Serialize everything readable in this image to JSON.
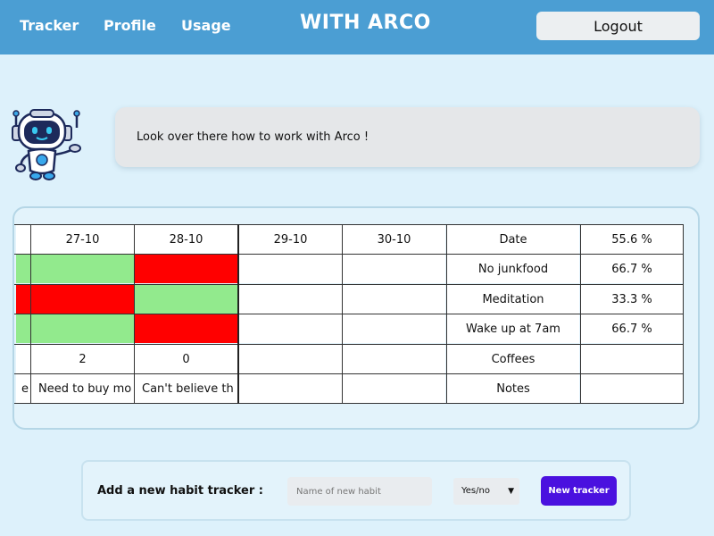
{
  "nav": {
    "tracker": "Tracker",
    "profile": "Profile",
    "usage": "Usage",
    "brand": "WITH ARCO",
    "logout": "Logout"
  },
  "assistant": {
    "message": "Look over there how to work with Arco !"
  },
  "tracker_table": {
    "dates": [
      "27-10",
      "28-10",
      "29-10",
      "30-10"
    ],
    "label_header": "Date",
    "habits": [
      {
        "name": "No junkfood",
        "percent": "66.7 %",
        "days": [
          "done",
          "missed",
          "",
          ""
        ]
      },
      {
        "name": "Meditation",
        "percent": "33.3 %",
        "days": [
          "missed",
          "done",
          "",
          ""
        ]
      },
      {
        "name": "Wake up at 7am",
        "percent": "66.7 %",
        "days": [
          "done",
          "missed",
          "",
          ""
        ]
      }
    ],
    "header_percent": "55.6 %",
    "coffees": {
      "label": "Coffees",
      "values": [
        "2",
        "0",
        "",
        ""
      ]
    },
    "notes": {
      "label": "Notes",
      "values": [
        "Need to buy mo",
        "Can't believe th",
        "",
        ""
      ],
      "partial_prev": "e"
    },
    "status_colors": {
      "done": "#92ea8d",
      "missed": "#ff0000"
    }
  },
  "new_habit_form": {
    "label": "Add a new habit tracker :",
    "input_placeholder": "Name of new habit",
    "type_selected": "Yes/no",
    "submit_label": "New tracker"
  }
}
